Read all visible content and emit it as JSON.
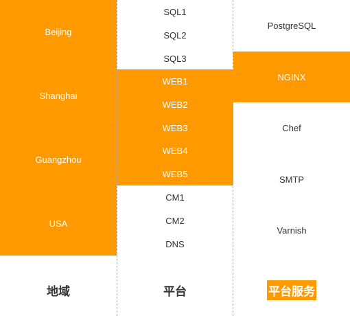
{
  "columns": {
    "region": {
      "title": "地域",
      "items": [
        "Beijing",
        "Shanghai",
        "Guangzhou",
        "USA"
      ]
    },
    "platform": {
      "title": "平台",
      "items": [
        "SQL1",
        "SQL2",
        "SQL3",
        "WEB1",
        "WEB2",
        "WEB3",
        "WEB4",
        "WEB5",
        "CM1",
        "CM2",
        "DNS"
      ]
    },
    "services": {
      "title": "平台服务",
      "items": [
        "PostgreSQL",
        "NGINX",
        "Chef",
        "SMTP",
        "Varnish"
      ]
    }
  },
  "colors": {
    "highlight": "#ff9900",
    "text": "#333333",
    "divider": "#a8a8a8"
  }
}
